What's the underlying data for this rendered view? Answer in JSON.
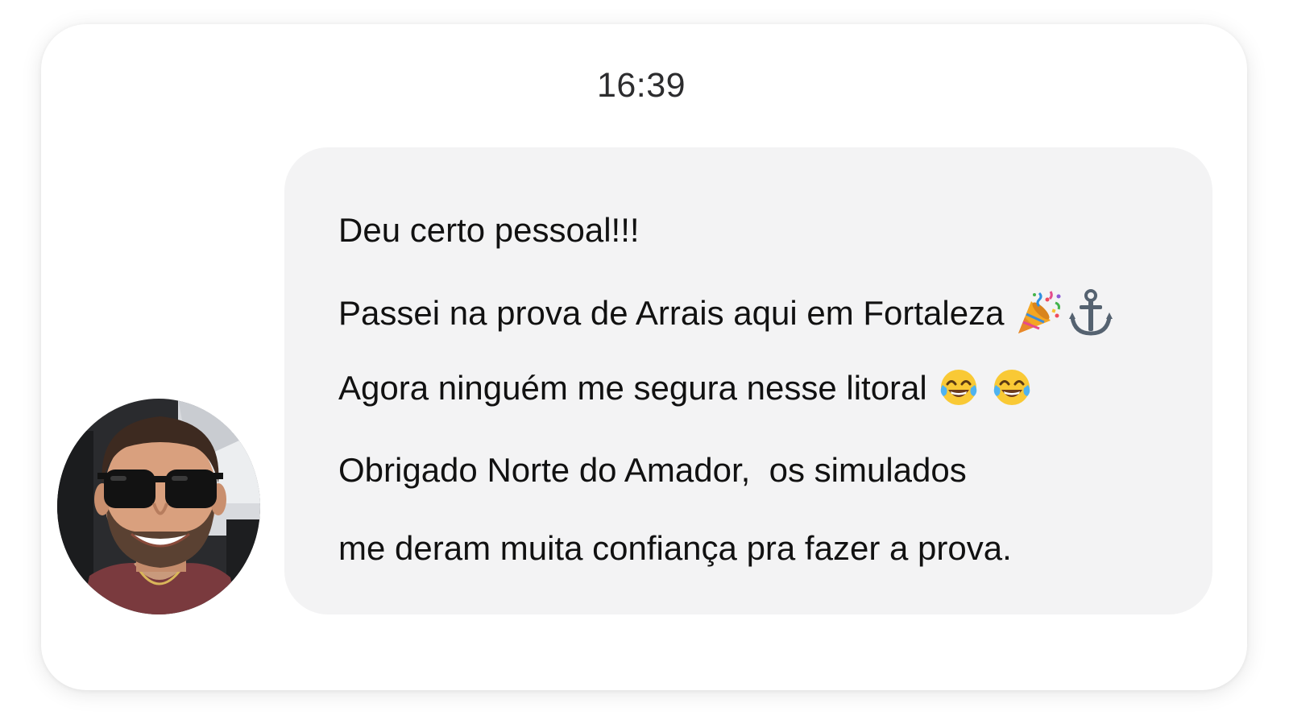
{
  "chat": {
    "timestamp": "16:39",
    "message": {
      "lines": [
        "Deu certo pessoal!!!",
        "Passei na prova de Arrais aqui em Fortaleza",
        "Agora ninguém me segura nesse litoral",
        "Obrigado Norte do Amador,  os simulados",
        "me deram muita confiança pra fazer a prova."
      ],
      "emojis": {
        "line2": [
          "party-popper",
          "anchor"
        ],
        "line3": [
          "face-with-tears-of-joy",
          "face-with-tears-of-joy"
        ]
      }
    },
    "sender": {
      "avatar": "profile-photo-man-sunglasses"
    }
  },
  "colors": {
    "bubble_bg": "#f3f3f4",
    "text": "#111111",
    "timestamp": "#2c2c2e",
    "card_bg": "#ffffff"
  }
}
